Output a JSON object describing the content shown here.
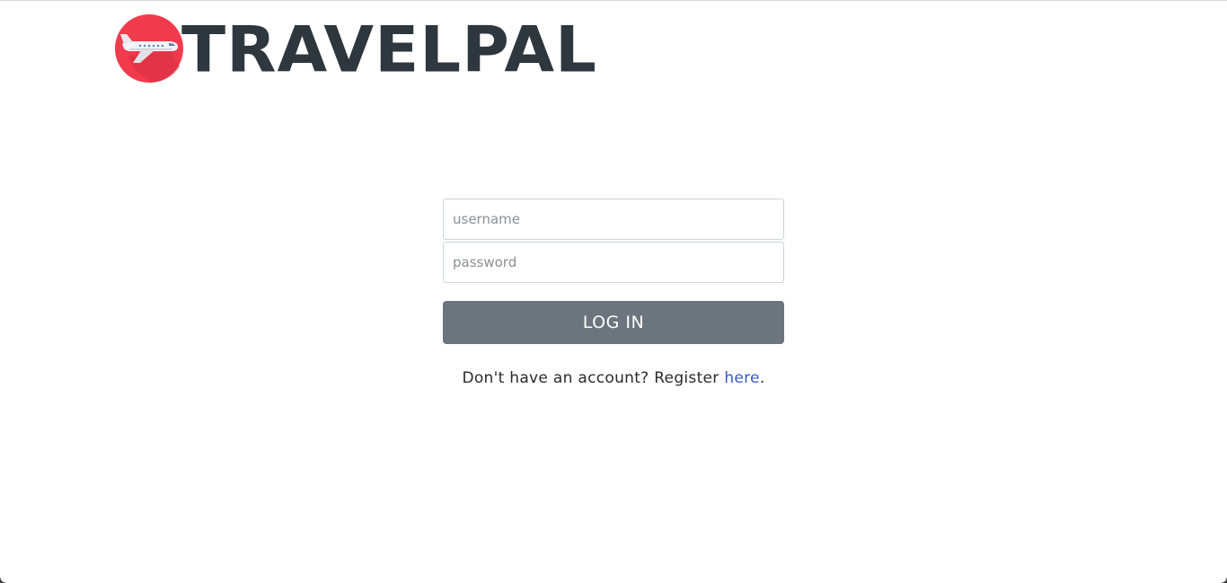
{
  "brand": {
    "name": "TRAVELPAL",
    "badge_color": "#f23a4d",
    "text_color": "#2e363e",
    "icon": "airplane-icon"
  },
  "login_form": {
    "username_placeholder": "username",
    "password_placeholder": "password",
    "submit_label": "LOG IN",
    "submit_color": "#6c757d"
  },
  "register": {
    "prefix": "Don't have an account? Register ",
    "link_label": "here",
    "suffix": ".",
    "link_color": "#3558c9"
  }
}
